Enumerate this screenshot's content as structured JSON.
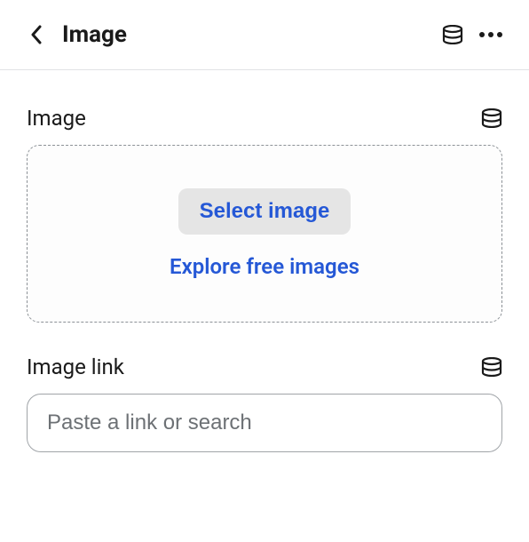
{
  "header": {
    "title": "Image"
  },
  "fields": {
    "image": {
      "label": "Image",
      "select_label": "Select image",
      "explore_label": "Explore free images"
    },
    "image_link": {
      "label": "Image link",
      "placeholder": "Paste a link or search",
      "value": ""
    }
  },
  "colors": {
    "accent": "#2558d6",
    "border": "#8c9196",
    "text": "#1a1a1a",
    "muted": "#6d7175"
  },
  "icons": {
    "back": "chevron-left",
    "database": "database-icon",
    "more": "more-horizontal"
  }
}
